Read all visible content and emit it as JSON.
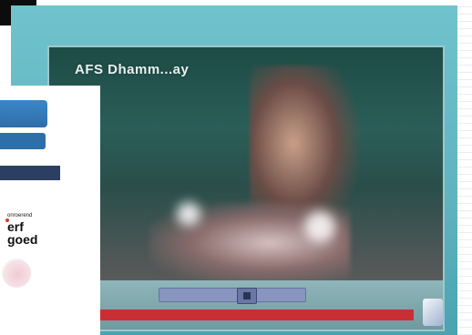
{
  "video": {
    "title": "AFS Dhamm...ay"
  },
  "logo": {
    "small": "onroerend",
    "line1": "erf",
    "line2": "goed"
  },
  "progress": {
    "fraction": 1.0
  },
  "colors": {
    "panel": "#5fb3bf",
    "progress": "#c92e34",
    "seek": "#8896bf"
  },
  "icons": {
    "player_corner": "fullscreen-icon"
  }
}
